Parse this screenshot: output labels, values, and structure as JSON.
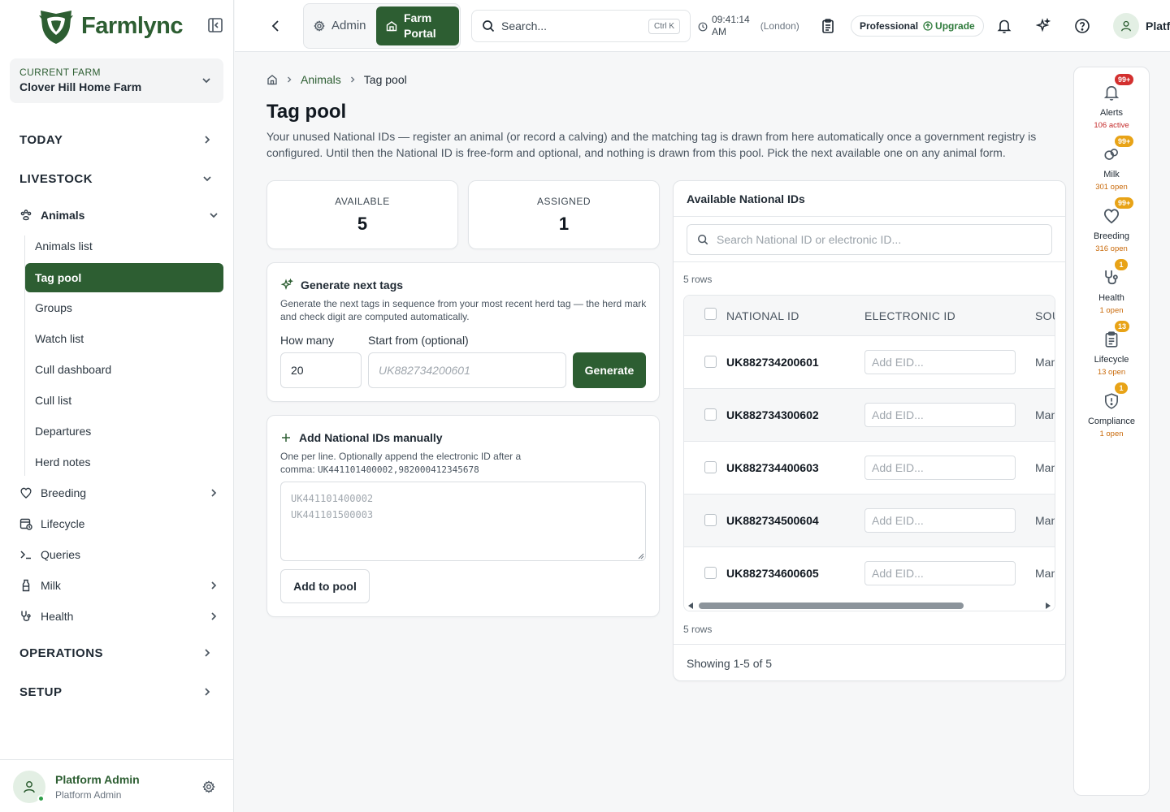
{
  "app": {
    "brand": "Farmlync"
  },
  "farm": {
    "label": "CURRENT FARM",
    "name": "Clover Hill Home Farm"
  },
  "nav": {
    "today": "TODAY",
    "livestock": "LIVESTOCK",
    "animals": "Animals",
    "animals_sub": [
      "Animals list",
      "Tag pool",
      "Groups",
      "Watch list",
      "Cull dashboard",
      "Cull list",
      "Departures",
      "Herd notes"
    ],
    "breeding": "Breeding",
    "lifecycle": "Lifecycle",
    "queries": "Queries",
    "milk": "Milk",
    "health": "Health",
    "operations": "OPERATIONS",
    "setup": "SETUP"
  },
  "user": {
    "name": "Platform Admin",
    "role": "Platform Admin",
    "header_name": "Platf"
  },
  "header": {
    "admin_tab": "Admin",
    "farm_tab_line1": "Farm",
    "farm_tab_line2": "Portal",
    "search_placeholder": "Search...",
    "search_shortcut": "Ctrl K",
    "time_line1": "09:41:14",
    "time_line2": "AM",
    "timezone": "(London)",
    "plan": "Professional",
    "upgrade": "Upgrade"
  },
  "breadcrumb": {
    "parent": "Animals",
    "current": "Tag pool"
  },
  "page": {
    "title": "Tag pool",
    "description": "Your unused National IDs — register an animal (or record a calving) and the matching tag is drawn from here automatically once a government registry is configured. Until then the National ID is free-form and optional, and nothing is drawn from this pool. Pick the next available one on any animal form."
  },
  "stats": {
    "available_label": "AVAILABLE",
    "available_value": "5",
    "assigned_label": "ASSIGNED",
    "assigned_value": "1"
  },
  "generate": {
    "title": "Generate next tags",
    "subtitle": "Generate the next tags in sequence from your most recent herd tag — the herd mark and check digit are computed automatically.",
    "how_many_label": "How many",
    "how_many_value": "20",
    "start_label": "Start from (optional)",
    "start_placeholder": "UK882734200601",
    "button": "Generate"
  },
  "manual": {
    "title": "Add National IDs manually",
    "hint": "One per line. Optionally append the electronic ID after a comma:",
    "hint_example": "UK441101400002,982000412345678",
    "placeholder": "UK441101400002\nUK441101500003",
    "button": "Add to pool"
  },
  "table": {
    "title": "Available National IDs",
    "search_placeholder": "Search National ID or electronic ID...",
    "rows_label": "5 rows",
    "columns": [
      "NATIONAL ID",
      "ELECTRONIC ID",
      "SOU"
    ],
    "eid_placeholder": "Add EID...",
    "rows": [
      {
        "national_id": "UK882734200601",
        "source": "Man"
      },
      {
        "national_id": "UK882734300602",
        "source": "Man"
      },
      {
        "national_id": "UK882734400603",
        "source": "Man"
      },
      {
        "national_id": "UK882734500604",
        "source": "Man"
      },
      {
        "national_id": "UK882734600605",
        "source": "Man"
      }
    ],
    "showing": "Showing 1-5 of 5"
  },
  "rail": [
    {
      "label": "Alerts",
      "badge": "99+",
      "count": "106 active"
    },
    {
      "label": "Milk",
      "badge": "99+",
      "count": "301 open"
    },
    {
      "label": "Breeding",
      "badge": "99+",
      "count": "316 open"
    },
    {
      "label": "Health",
      "badge": "1",
      "count": "1 open"
    },
    {
      "label": "Lifecycle",
      "badge": "13",
      "count": "13 open"
    },
    {
      "label": "Compliance",
      "badge": "1",
      "count": "1 open"
    }
  ],
  "colors": {
    "brand_green": "#2d5e32",
    "badge_orange": "#e8a317",
    "badge_red": "#d3302f"
  }
}
